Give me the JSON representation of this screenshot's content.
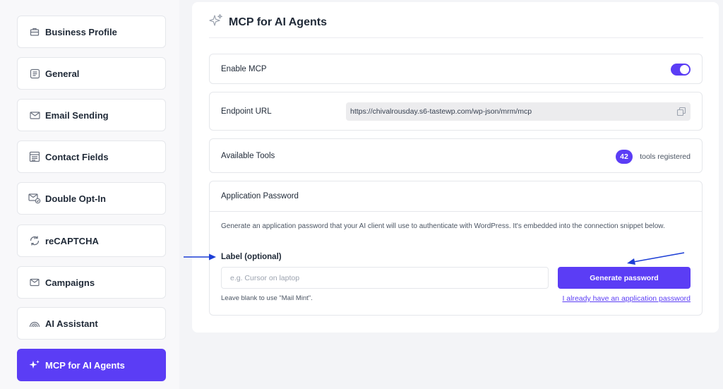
{
  "sidebar": {
    "items": [
      {
        "label": "Business Profile",
        "icon": "briefcase-icon"
      },
      {
        "label": "General",
        "icon": "document-icon"
      },
      {
        "label": "Email Sending",
        "icon": "envelope-icon"
      },
      {
        "label": "Contact Fields",
        "icon": "form-list-icon"
      },
      {
        "label": "Double Opt-In",
        "icon": "envelope-check-icon"
      },
      {
        "label": "reCAPTCHA",
        "icon": "recaptcha-icon"
      },
      {
        "label": "Campaigns",
        "icon": "envelope-icon"
      },
      {
        "label": "AI Assistant",
        "icon": "rainbow-arc-icon"
      },
      {
        "label": "MCP for AI Agents",
        "icon": "sparkle-icon",
        "active": true
      }
    ]
  },
  "panel": {
    "title": "MCP for AI Agents",
    "title_icon": "sparkle-icon"
  },
  "enable_mcp": {
    "label": "Enable MCP",
    "enabled": true
  },
  "endpoint": {
    "label": "Endpoint URL",
    "url": "https://chivalrousday.s6-tastewp.com/wp-json/mrm/mcp",
    "copy_icon": "copy-icon"
  },
  "tools": {
    "label": "Available Tools",
    "count": "42",
    "suffix": "tools registered"
  },
  "app_password": {
    "heading": "Application Password",
    "description": "Generate an application password that your AI client will use to authenticate with WordPress. It's embedded into the connection snippet below.",
    "field_label": "Label (optional)",
    "input_placeholder": "e.g. Cursor on laptop",
    "input_value": "",
    "hint": "Leave blank to use \"Mail Mint\".",
    "generate_label": "Generate password",
    "existing_link": "I already have an application password"
  },
  "colors": {
    "accent": "#5b3df5",
    "annotation_arrow": "#1d3fd6"
  }
}
